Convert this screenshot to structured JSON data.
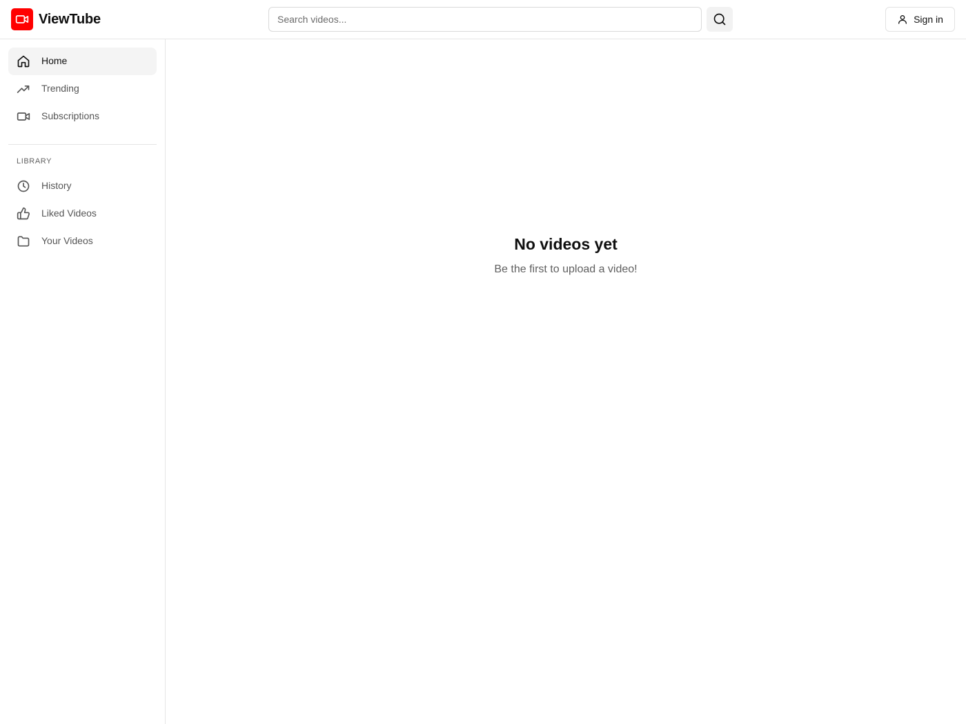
{
  "app": {
    "name": "ViewTube",
    "brand_color": "#ff0000",
    "logo_icon": "video-camera-icon"
  },
  "header": {
    "search_placeholder": "Search videos...",
    "search_icon": "search-icon",
    "signin_label": "Sign in",
    "signin_icon": "user-icon"
  },
  "sidebar": {
    "items": [
      {
        "label": "Home",
        "icon": "home-icon",
        "active": true
      },
      {
        "label": "Trending",
        "icon": "trending-up-icon",
        "active": false
      },
      {
        "label": "Subscriptions",
        "icon": "video-camera-icon",
        "active": false
      }
    ],
    "library": {
      "title": "LIBRARY",
      "items": [
        {
          "label": "History",
          "icon": "clock-icon"
        },
        {
          "label": "Liked Videos",
          "icon": "thumbs-up-icon"
        },
        {
          "label": "Your Videos",
          "icon": "folder-icon"
        }
      ]
    }
  },
  "main": {
    "empty_title": "No videos yet",
    "empty_subtitle": "Be the first to upload a video!"
  }
}
